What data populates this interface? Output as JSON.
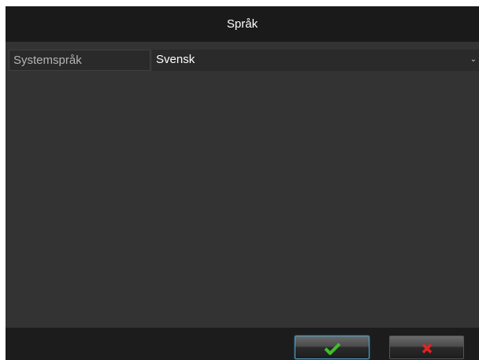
{
  "dialog": {
    "title": "Språk"
  },
  "language_setting": {
    "label": "Systemspråk",
    "selected_value": "Svensk"
  },
  "footer": {
    "confirm_icon": "checkmark-icon",
    "cancel_icon": "close-icon",
    "confirm_color": "#3fbf2a",
    "cancel_color": "#e32222"
  }
}
